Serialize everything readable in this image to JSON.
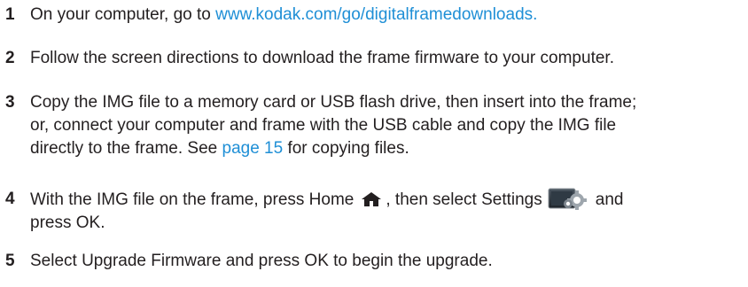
{
  "steps": [
    {
      "number": "1",
      "text_before": "On your computer, go to ",
      "link": "www.kodak.com/go/digitalframedownloads."
    },
    {
      "number": "2",
      "text": "Follow the screen directions to download the frame firmware to your computer."
    },
    {
      "number": "3",
      "line1": "Copy the IMG file to a memory card or USB flash drive, then insert into the frame;",
      "line2": "or, connect your computer and frame with the USB cable and copy the IMG file",
      "line3_before": "directly to the frame. See ",
      "link": "page 15",
      "line3_after": " for copying files."
    },
    {
      "number": "4",
      "text_before": "With the IMG file on the frame, press Home",
      "text_middle": ", then select Settings",
      "text_after": "and",
      "line2": "press OK.",
      "icons": [
        "home-icon",
        "settings-icon"
      ]
    },
    {
      "number": "5",
      "text": "Select Upgrade Firmware and press OK to begin the upgrade."
    }
  ],
  "colors": {
    "text": "#231f20",
    "link": "#1f8fd6"
  }
}
